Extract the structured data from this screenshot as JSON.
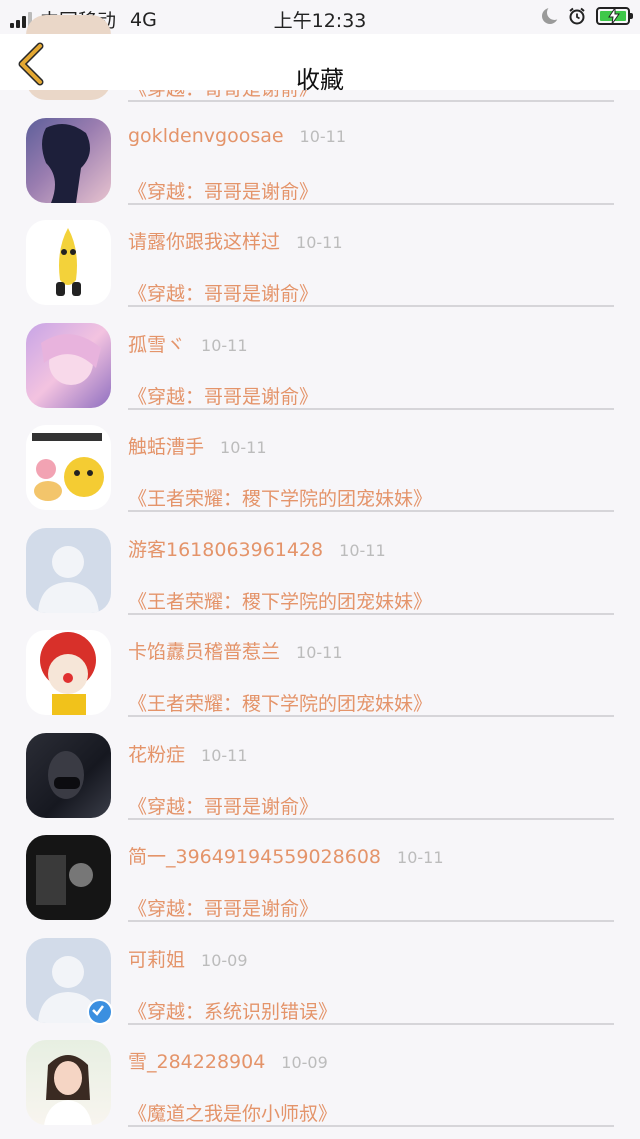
{
  "status_bar": {
    "carrier": "中国移动",
    "network": "4G",
    "time": "上午12:33"
  },
  "header": {
    "title": "收藏",
    "back_icon": "chevron-left-icon",
    "back_color": "#e4a832"
  },
  "colors": {
    "accent": "#e4946a",
    "date": "#bcbcbc"
  },
  "items": [
    {
      "name": "",
      "date": "",
      "book": "《穿越：哥哥是谢俞》",
      "avatar": "partial-avatar"
    },
    {
      "name": "gokldenvgoosae",
      "date": "10-11",
      "book": "《穿越：哥哥是谢俞》",
      "avatar": "anime-boy-avatar"
    },
    {
      "name": "请露你跟我这样过",
      "date": "10-11",
      "book": "《穿越：哥哥是谢俞》",
      "avatar": "banana-avatar"
    },
    {
      "name": "孤雪ヾ",
      "date": "10-11",
      "book": "《穿越：哥哥是谢俞》",
      "avatar": "anime-girl-avatar"
    },
    {
      "name": "触蛞漕手",
      "date": "10-11",
      "book": "《王者荣耀：稷下学院的团宠妹妹》",
      "avatar": "emoji-meme-avatar"
    },
    {
      "name": "游客1618063961428",
      "date": "10-11",
      "book": "《王者荣耀：稷下学院的团宠妹妹》",
      "avatar": "default-avatar"
    },
    {
      "name": "卡馅纛员稽普惹兰",
      "date": "10-11",
      "book": "《王者荣耀：稷下学院的团宠妹妹》",
      "avatar": "clown-avatar"
    },
    {
      "name": "花粉症",
      "date": "10-11",
      "book": "《穿越：哥哥是谢俞》",
      "avatar": "masked-person-avatar"
    },
    {
      "name": "简一_39649194559028608",
      "date": "10-11",
      "book": "《穿越：哥哥是谢俞》",
      "avatar": "dark-photo-avatar"
    },
    {
      "name": "可莉姐",
      "date": "10-09",
      "book": "《穿越：系统识别错误》",
      "avatar": "default-avatar-verified"
    },
    {
      "name": "雪_284228904",
      "date": "10-09",
      "book": "《魔道之我是你小师叔》",
      "avatar": "woman-photo-avatar"
    }
  ]
}
